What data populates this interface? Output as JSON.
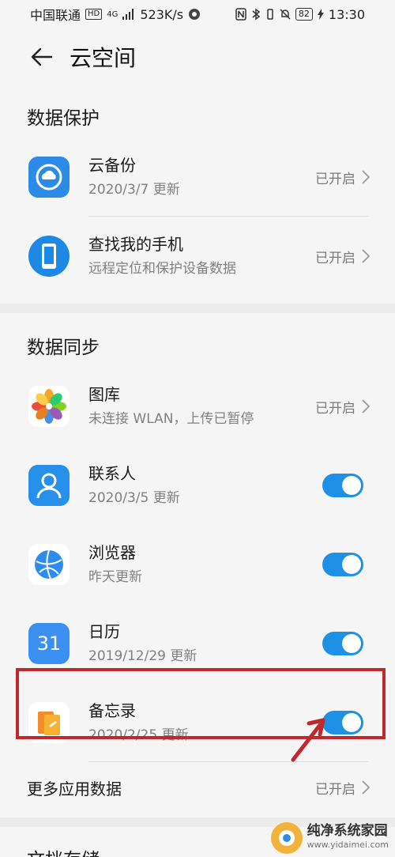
{
  "status_bar": {
    "carrier": "中国联通",
    "hd": "HD",
    "network": "4G",
    "speed": "523K/s",
    "battery": "82",
    "time": "13:30"
  },
  "header": {
    "title": "云空间"
  },
  "sections": {
    "protection": {
      "title": "数据保护",
      "items": [
        {
          "title": "云备份",
          "subtitle": "2020/3/7 更新",
          "status": "已开启",
          "icon": "cloud-backup-icon"
        },
        {
          "title": "查找我的手机",
          "subtitle": "远程定位和保护设备数据",
          "status": "已开启",
          "icon": "find-phone-icon"
        }
      ]
    },
    "sync": {
      "title": "数据同步",
      "gallery": {
        "title": "图库",
        "subtitle": "未连接 WLAN，上传已暂停",
        "status": "已开启",
        "icon": "gallery-icon"
      },
      "contacts": {
        "title": "联系人",
        "subtitle": "2020/3/5 更新",
        "icon": "contacts-icon",
        "on": true
      },
      "browser": {
        "title": "浏览器",
        "subtitle": "昨天更新",
        "icon": "browser-icon",
        "on": true
      },
      "calendar": {
        "title": "日历",
        "subtitle": "2019/12/29 更新",
        "icon": "calendar-icon",
        "day": "31",
        "on": true
      },
      "memo": {
        "title": "备忘录",
        "subtitle": "2020/2/25 更新",
        "icon": "memo-icon",
        "on": true
      },
      "more": {
        "title": "更多应用数据",
        "status": "已开启"
      }
    },
    "docs": {
      "title": "文档存储"
    }
  },
  "watermark": {
    "name": "纯净系统家园",
    "url": "www.yidaimei.com"
  },
  "colors": {
    "accent": "#1e90e6",
    "highlight": "#c0282e"
  }
}
